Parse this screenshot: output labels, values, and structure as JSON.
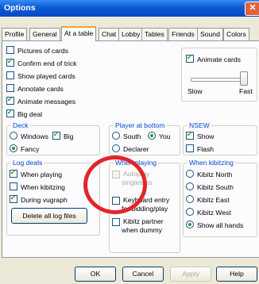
{
  "window": {
    "title": "Options",
    "close": "✕"
  },
  "tabs": [
    "Profile",
    "General",
    "At a table",
    "Chat",
    "Lobby",
    "Tables",
    "Friends",
    "Sound",
    "Colors"
  ],
  "general": {
    "pictures_of_cards": "Pictures of cards",
    "confirm_end_of_trick": "Confirm end of trick",
    "show_played_cards": "Show played cards",
    "annotate_cards": "Annotate cards",
    "animate_messages": "Animate messages",
    "big_deal": "Big deal"
  },
  "animate": {
    "label": "Animate cards",
    "slow": "Slow",
    "fast": "Fast"
  },
  "deck": {
    "legend": "Deck",
    "windows": "Windows",
    "big": "Big",
    "fancy": "Fancy"
  },
  "player_at_bottom": {
    "legend": "Player at bottom",
    "south": "South",
    "you": "You",
    "declarer": "Declarer"
  },
  "nsew": {
    "legend": "NSEW",
    "show": "Show",
    "flash": "Flash"
  },
  "log_deals": {
    "legend": "Log deals",
    "when_playing": "When playing",
    "when_kibitzing": "When kibitzing",
    "during_vugraph": "During vugraph",
    "delete_button": "Delete all log files"
  },
  "when_playing": {
    "legend": "When playing",
    "autoplay": "Autoplay singletons",
    "keyboard": "Keyboard entry for bidding/play",
    "kibitz_partner": "Kibitz partner when dummy"
  },
  "when_kibitzing": {
    "legend": "When kibitzing",
    "north": "Kibitz North",
    "south": "Kibitz South",
    "east": "Kibitz East",
    "west": "Kibitz West",
    "all": "Show all hands"
  },
  "footer": {
    "ok": "OK",
    "cancel": "Cancel",
    "apply": "Apply",
    "help": "Help"
  }
}
